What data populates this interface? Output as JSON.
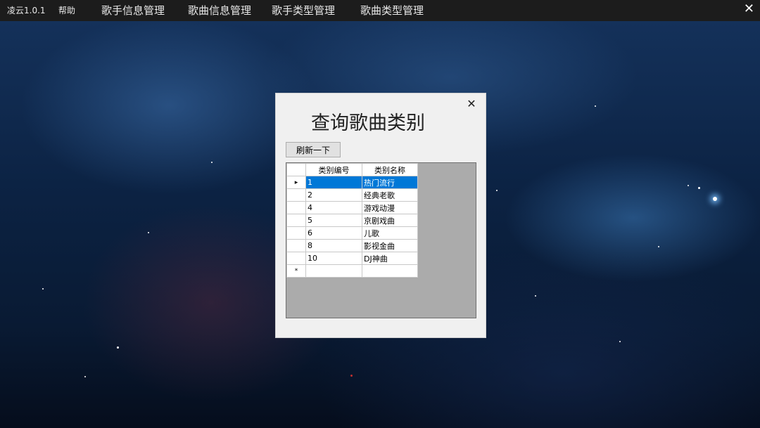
{
  "menubar": {
    "app_title": "凌云1.0.1",
    "items": [
      "帮助",
      "歌手信息管理",
      "歌曲信息管理",
      "歌手类型管理",
      "歌曲类型管理"
    ],
    "close_glyph": "✕"
  },
  "dialog": {
    "close_glyph": "✕",
    "title": "查询歌曲类别",
    "refresh_label": "刷新一下",
    "grid": {
      "columns": [
        "类别编号",
        "类别名称"
      ],
      "rows": [
        [
          "1",
          "热门流行"
        ],
        [
          "2",
          "经典老歌"
        ],
        [
          "4",
          "游戏动漫"
        ],
        [
          "5",
          "京剧戏曲"
        ],
        [
          "6",
          "儿歌"
        ],
        [
          "8",
          "影视金曲"
        ],
        [
          "10",
          "DJ神曲"
        ]
      ],
      "selected_row_marker": "▸",
      "new_row_marker": "*"
    }
  },
  "colors": {
    "menubar_bg": "#1c1c1c",
    "selection": "#0078d7",
    "grid_bg": "#ababab"
  }
}
